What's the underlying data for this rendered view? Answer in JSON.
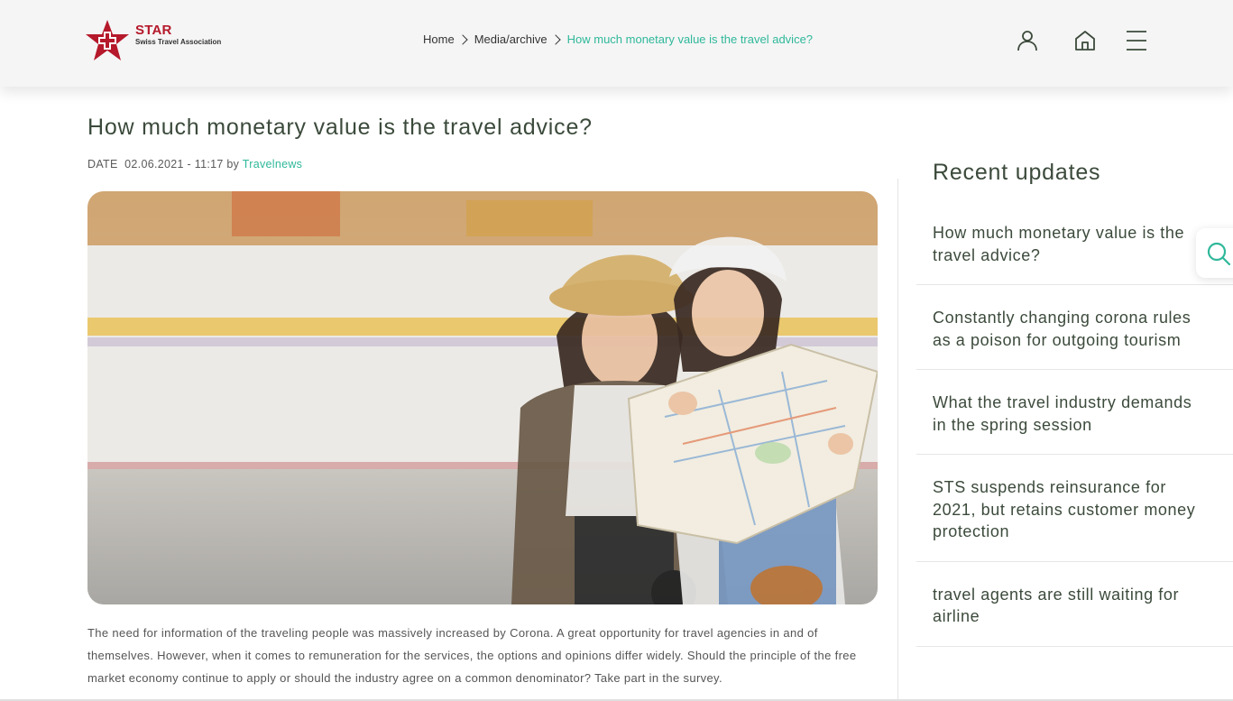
{
  "header": {
    "logo": {
      "brand": "STAR",
      "subtitle": "Swiss Travel Association"
    },
    "breadcrumb": {
      "home": "Home",
      "section": "Media/archive",
      "current": "How much monetary value is the travel advice?"
    },
    "icons": [
      "user-icon",
      "home-icon",
      "menu-icon"
    ]
  },
  "article": {
    "title": "How much monetary value is the travel advice?",
    "meta": {
      "date_label": "DATE",
      "date": "02.06.2021 - 11:17",
      "by": "by",
      "author": "Travelnews"
    },
    "body": "The need for information of the traveling people was massively increased by Corona. A great opportunity for travel agencies in and of themselves. However, when it comes to remuneration for the services, the options and opinions differ widely. Should the principle of the free market economy continue to apply or should the industry agree on a common denominator? Take part in the survey."
  },
  "sidebar": {
    "title": "Recent updates",
    "items": [
      {
        "label": "How much monetary value is the travel advice?"
      },
      {
        "label": "Constantly changing corona rules as a poison for outgoing tourism"
      },
      {
        "label": "What the travel industry demands in the spring session"
      },
      {
        "label": "STS suspends reinsurance for 2021, but retains customer money protection"
      },
      {
        "label": "travel agents are still waiting for airline"
      }
    ]
  },
  "colors": {
    "accent": "#2fb89a",
    "brand": "#b5192b",
    "text": "#3b4a3b"
  }
}
